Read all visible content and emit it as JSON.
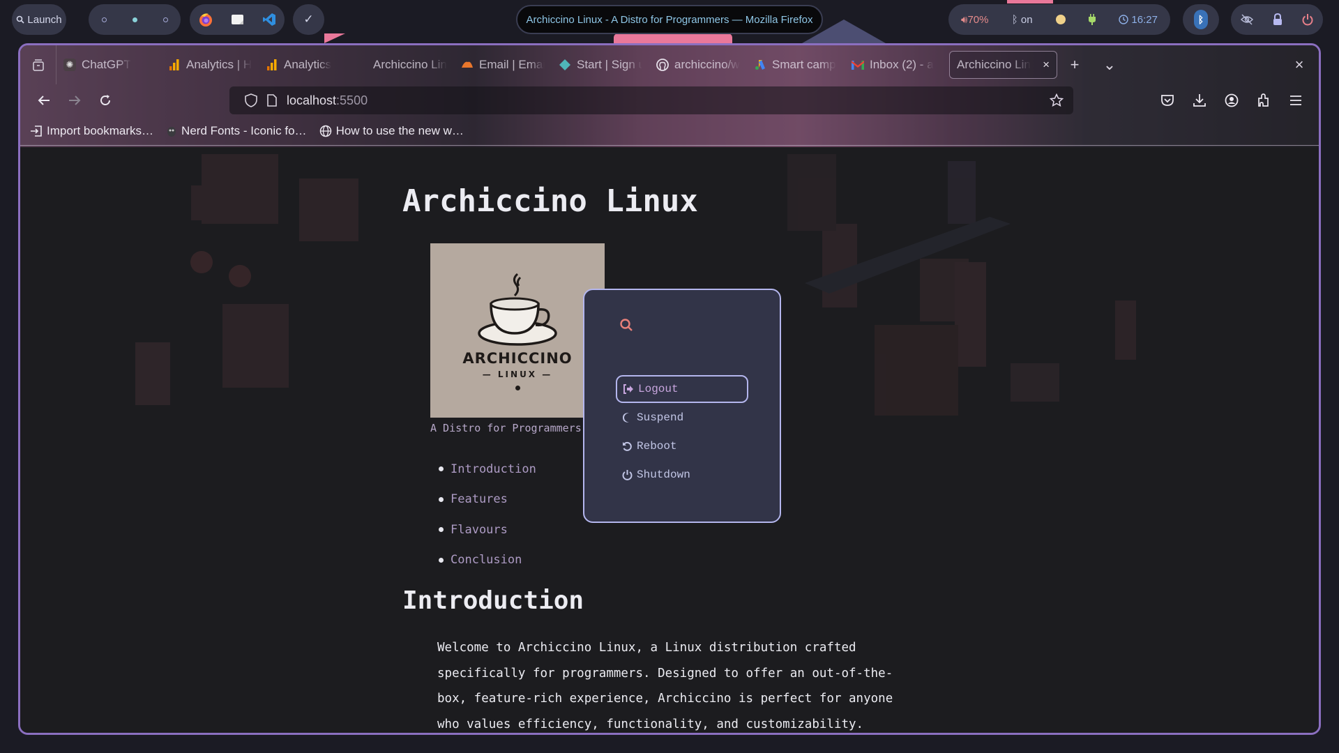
{
  "panel": {
    "launcher": {
      "icon": "search-icon",
      "label": "Launch"
    },
    "workspaces": [
      {
        "id": 1,
        "active": false
      },
      {
        "id": 2,
        "active": true
      },
      {
        "id": 3,
        "active": false
      }
    ],
    "apps": [
      {
        "name": "Firefox",
        "icon": "firefox-icon"
      },
      {
        "name": "Files",
        "icon": "files-icon"
      },
      {
        "name": "VS Code",
        "icon": "vscode-icon"
      }
    ],
    "check_label": "✓",
    "window_title": "Archiccino Linux - A Distro for Programmers — Mozilla Firefox",
    "status": {
      "volume": "70%",
      "bluetooth": "on",
      "clock": "16:27"
    },
    "colors": {
      "volume": "#e58b8b",
      "clock": "#8eb0e8",
      "battery_dot": "#f0d18a",
      "plug": "#a6d96a",
      "power": "#e8808a",
      "lock": "#b7b9f0"
    }
  },
  "browser": {
    "tabs": [
      {
        "label": "ChatGPT",
        "favicon": "chatgpt-icon"
      },
      {
        "label": "Analytics | H",
        "favicon": "analytics-icon"
      },
      {
        "label": "Analytics",
        "favicon": "analytics-icon"
      },
      {
        "label": "Archiccino Linux",
        "favicon": "none"
      },
      {
        "label": "Email | Emai",
        "favicon": "email-icon"
      },
      {
        "label": "Start | Sign u",
        "favicon": "diamond-icon"
      },
      {
        "label": "archiccino/w",
        "favicon": "github-icon"
      },
      {
        "label": "Smart camp",
        "favicon": "google-ads-icon"
      },
      {
        "label": "Inbox (2) - a",
        "favicon": "gmail-icon"
      }
    ],
    "active_tab": {
      "label": "Archiccino Lin",
      "close": "×"
    },
    "new_tab": "+",
    "list_all_tabs": "⌄",
    "close_window": "×",
    "url": {
      "host": "localhost",
      "port": ":5500"
    },
    "bookmarks": [
      {
        "label": "Import bookmarks…",
        "icon": "import-icon"
      },
      {
        "label": "Nerd Fonts - Iconic fo…",
        "icon": "nerd-fonts-icon"
      },
      {
        "label": "How to use the new w…",
        "icon": "globe-icon"
      }
    ]
  },
  "page": {
    "title": "Archiccino Linux",
    "logo": {
      "brand": "ARCHICCINO",
      "sub": "— LINUX —"
    },
    "caption": "A Distro for Programmers",
    "toc": [
      "Introduction",
      "Features",
      "Flavours",
      "Conclusion"
    ],
    "section_heading": "Introduction",
    "intro_text": "Welcome to Archiccino Linux, a Linux distribution crafted specifically for programmers. Designed to offer an out-of-the-box, feature-rich experience, Archiccino is perfect for anyone who values efficiency, functionality, and customizability."
  },
  "power_menu": {
    "search_placeholder": "",
    "items": [
      {
        "label": "Logout",
        "icon": "logout-icon",
        "selected": true
      },
      {
        "label": "Suspend",
        "icon": "moon-icon",
        "selected": false
      },
      {
        "label": "Reboot",
        "icon": "reboot-icon",
        "selected": false
      },
      {
        "label": "Shutdown",
        "icon": "power-icon",
        "selected": false
      }
    ],
    "colors": {
      "background": "#323448",
      "border": "#b4b6ee",
      "search_icon": "#e8807a",
      "selected_text": "#c8a6de"
    }
  }
}
